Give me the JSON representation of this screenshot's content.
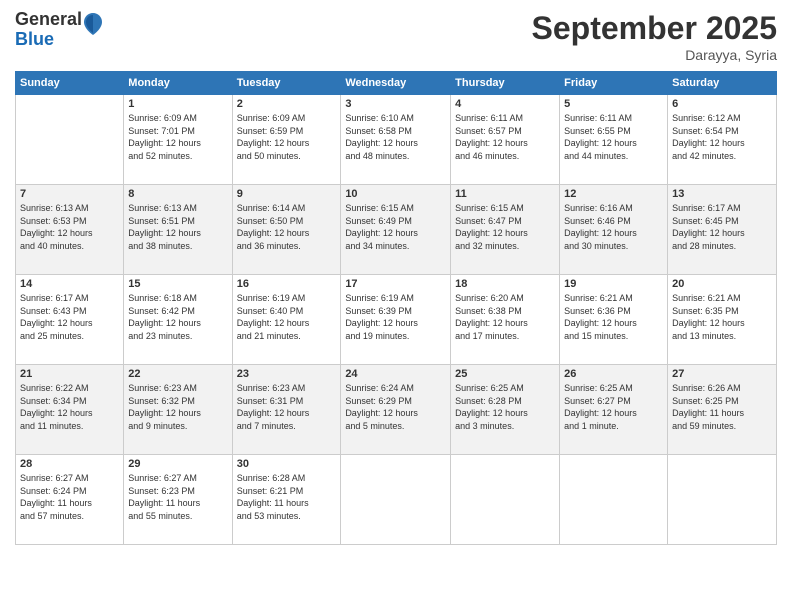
{
  "header": {
    "logo_general": "General",
    "logo_blue": "Blue",
    "month_title": "September 2025",
    "location": "Darayya, Syria"
  },
  "weekdays": [
    "Sunday",
    "Monday",
    "Tuesday",
    "Wednesday",
    "Thursday",
    "Friday",
    "Saturday"
  ],
  "weeks": [
    [
      {
        "day": "",
        "info": ""
      },
      {
        "day": "1",
        "info": "Sunrise: 6:09 AM\nSunset: 7:01 PM\nDaylight: 12 hours\nand 52 minutes."
      },
      {
        "day": "2",
        "info": "Sunrise: 6:09 AM\nSunset: 6:59 PM\nDaylight: 12 hours\nand 50 minutes."
      },
      {
        "day": "3",
        "info": "Sunrise: 6:10 AM\nSunset: 6:58 PM\nDaylight: 12 hours\nand 48 minutes."
      },
      {
        "day": "4",
        "info": "Sunrise: 6:11 AM\nSunset: 6:57 PM\nDaylight: 12 hours\nand 46 minutes."
      },
      {
        "day": "5",
        "info": "Sunrise: 6:11 AM\nSunset: 6:55 PM\nDaylight: 12 hours\nand 44 minutes."
      },
      {
        "day": "6",
        "info": "Sunrise: 6:12 AM\nSunset: 6:54 PM\nDaylight: 12 hours\nand 42 minutes."
      }
    ],
    [
      {
        "day": "7",
        "info": "Sunrise: 6:13 AM\nSunset: 6:53 PM\nDaylight: 12 hours\nand 40 minutes."
      },
      {
        "day": "8",
        "info": "Sunrise: 6:13 AM\nSunset: 6:51 PM\nDaylight: 12 hours\nand 38 minutes."
      },
      {
        "day": "9",
        "info": "Sunrise: 6:14 AM\nSunset: 6:50 PM\nDaylight: 12 hours\nand 36 minutes."
      },
      {
        "day": "10",
        "info": "Sunrise: 6:15 AM\nSunset: 6:49 PM\nDaylight: 12 hours\nand 34 minutes."
      },
      {
        "day": "11",
        "info": "Sunrise: 6:15 AM\nSunset: 6:47 PM\nDaylight: 12 hours\nand 32 minutes."
      },
      {
        "day": "12",
        "info": "Sunrise: 6:16 AM\nSunset: 6:46 PM\nDaylight: 12 hours\nand 30 minutes."
      },
      {
        "day": "13",
        "info": "Sunrise: 6:17 AM\nSunset: 6:45 PM\nDaylight: 12 hours\nand 28 minutes."
      }
    ],
    [
      {
        "day": "14",
        "info": "Sunrise: 6:17 AM\nSunset: 6:43 PM\nDaylight: 12 hours\nand 25 minutes."
      },
      {
        "day": "15",
        "info": "Sunrise: 6:18 AM\nSunset: 6:42 PM\nDaylight: 12 hours\nand 23 minutes."
      },
      {
        "day": "16",
        "info": "Sunrise: 6:19 AM\nSunset: 6:40 PM\nDaylight: 12 hours\nand 21 minutes."
      },
      {
        "day": "17",
        "info": "Sunrise: 6:19 AM\nSunset: 6:39 PM\nDaylight: 12 hours\nand 19 minutes."
      },
      {
        "day": "18",
        "info": "Sunrise: 6:20 AM\nSunset: 6:38 PM\nDaylight: 12 hours\nand 17 minutes."
      },
      {
        "day": "19",
        "info": "Sunrise: 6:21 AM\nSunset: 6:36 PM\nDaylight: 12 hours\nand 15 minutes."
      },
      {
        "day": "20",
        "info": "Sunrise: 6:21 AM\nSunset: 6:35 PM\nDaylight: 12 hours\nand 13 minutes."
      }
    ],
    [
      {
        "day": "21",
        "info": "Sunrise: 6:22 AM\nSunset: 6:34 PM\nDaylight: 12 hours\nand 11 minutes."
      },
      {
        "day": "22",
        "info": "Sunrise: 6:23 AM\nSunset: 6:32 PM\nDaylight: 12 hours\nand 9 minutes."
      },
      {
        "day": "23",
        "info": "Sunrise: 6:23 AM\nSunset: 6:31 PM\nDaylight: 12 hours\nand 7 minutes."
      },
      {
        "day": "24",
        "info": "Sunrise: 6:24 AM\nSunset: 6:29 PM\nDaylight: 12 hours\nand 5 minutes."
      },
      {
        "day": "25",
        "info": "Sunrise: 6:25 AM\nSunset: 6:28 PM\nDaylight: 12 hours\nand 3 minutes."
      },
      {
        "day": "26",
        "info": "Sunrise: 6:25 AM\nSunset: 6:27 PM\nDaylight: 12 hours\nand 1 minute."
      },
      {
        "day": "27",
        "info": "Sunrise: 6:26 AM\nSunset: 6:25 PM\nDaylight: 11 hours\nand 59 minutes."
      }
    ],
    [
      {
        "day": "28",
        "info": "Sunrise: 6:27 AM\nSunset: 6:24 PM\nDaylight: 11 hours\nand 57 minutes."
      },
      {
        "day": "29",
        "info": "Sunrise: 6:27 AM\nSunset: 6:23 PM\nDaylight: 11 hours\nand 55 minutes."
      },
      {
        "day": "30",
        "info": "Sunrise: 6:28 AM\nSunset: 6:21 PM\nDaylight: 11 hours\nand 53 minutes."
      },
      {
        "day": "",
        "info": ""
      },
      {
        "day": "",
        "info": ""
      },
      {
        "day": "",
        "info": ""
      },
      {
        "day": "",
        "info": ""
      }
    ]
  ]
}
